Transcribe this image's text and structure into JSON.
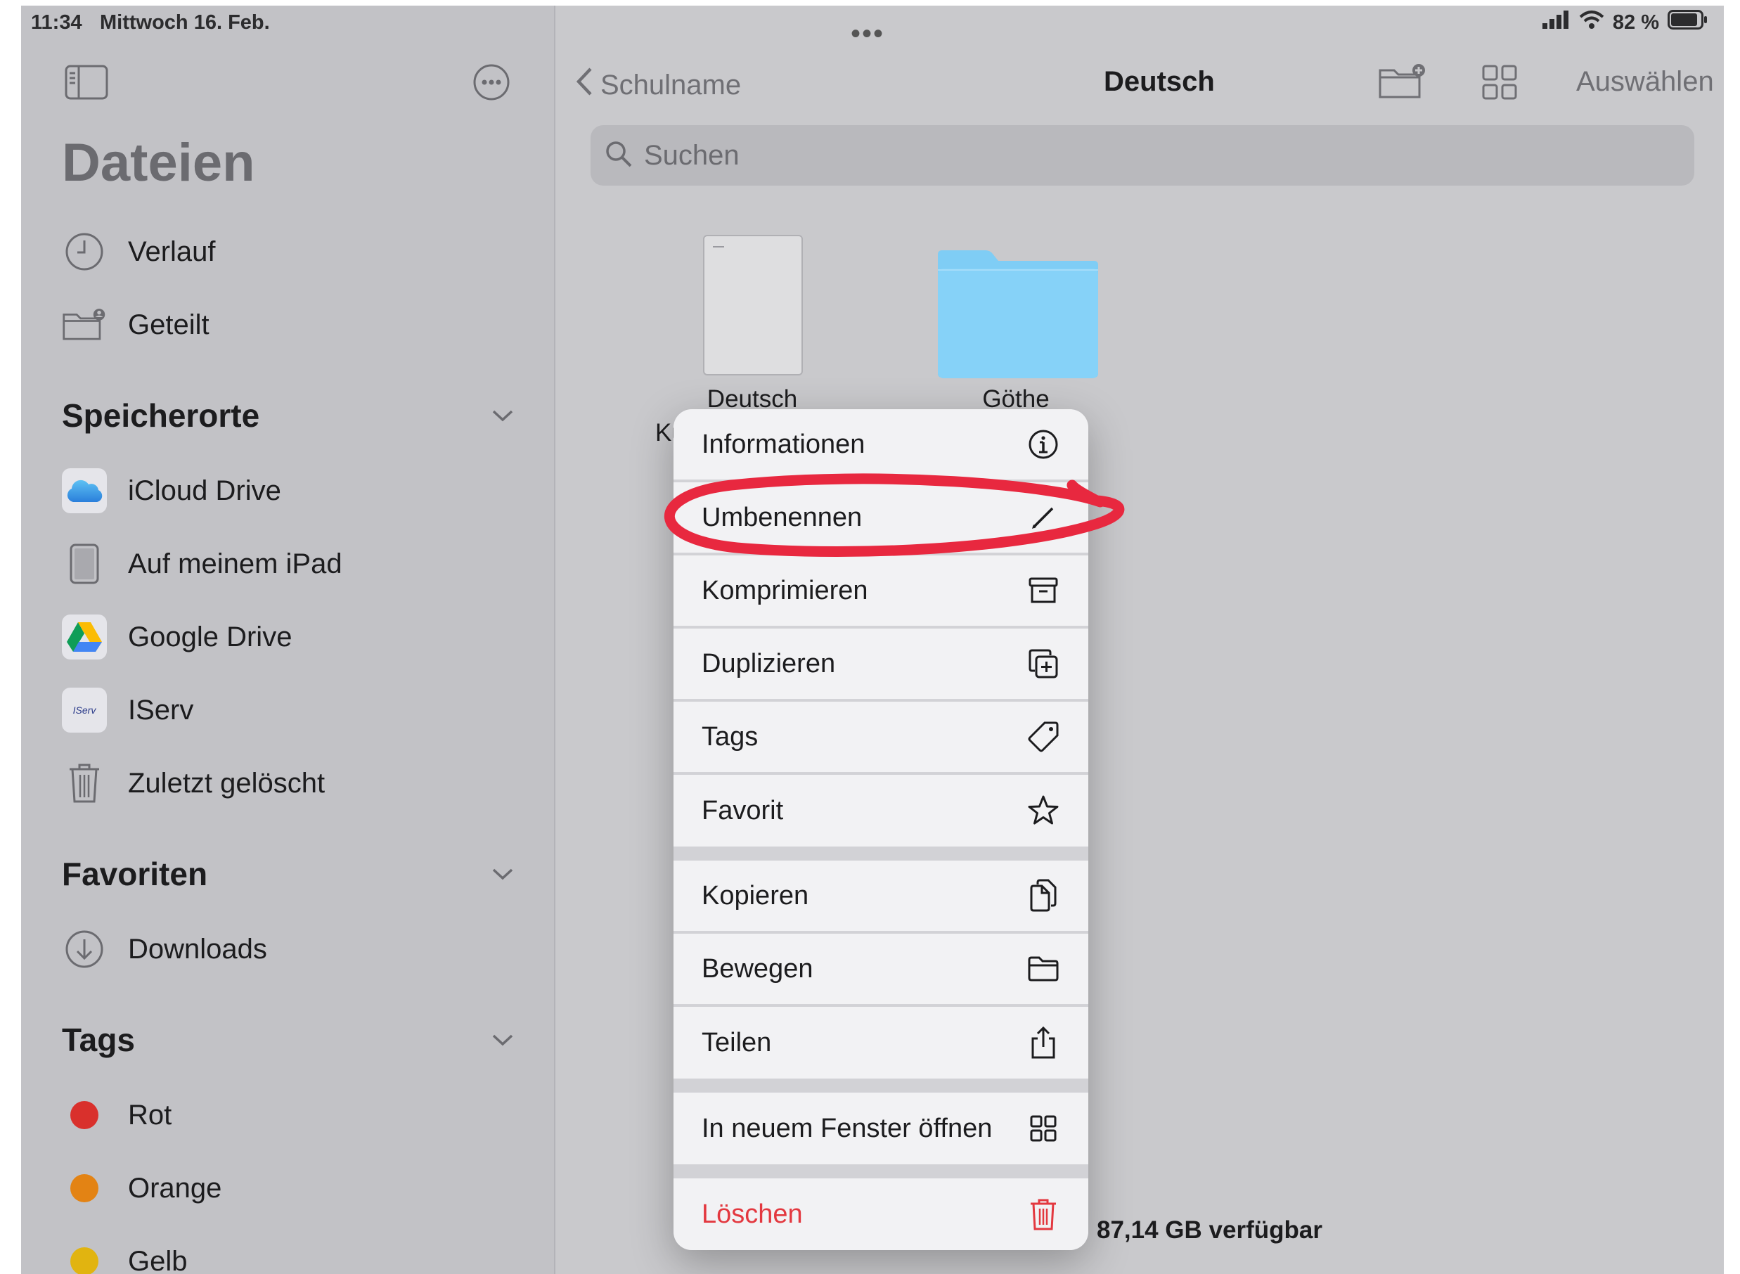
{
  "status": {
    "time": "11:34",
    "date": "Mittwoch 16. Feb.",
    "battery": "82 %"
  },
  "sidebar": {
    "title": "Dateien",
    "top_items": [
      {
        "label": "Verlauf",
        "icon": "clock-icon"
      },
      {
        "label": "Geteilt",
        "icon": "shared-folder-icon"
      }
    ],
    "sections": {
      "locations": "Speicherorte",
      "favorites": "Favoriten",
      "tags": "Tags"
    },
    "locations": [
      {
        "label": "iCloud Drive",
        "icon": "icloud-icon"
      },
      {
        "label": "Auf meinem iPad",
        "icon": "ipad-icon"
      },
      {
        "label": "Google Drive",
        "icon": "google-drive-icon"
      },
      {
        "label": "IServ",
        "icon": "iserv-icon",
        "logo_text": "IServ"
      },
      {
        "label": "Zuletzt gelöscht",
        "icon": "trash-icon"
      }
    ],
    "favorites": [
      {
        "label": "Downloads",
        "icon": "download-icon"
      }
    ],
    "tags": [
      {
        "label": "Rot",
        "color": "#d9302c"
      },
      {
        "label": "Orange",
        "color": "#e38314"
      },
      {
        "label": "Gelb",
        "color": "#e1b410"
      }
    ]
  },
  "main": {
    "back_label": "Schulname",
    "title": "Deutsch",
    "select_label": "Auswählen",
    "search_placeholder": "Suchen",
    "files": [
      {
        "label": "Deutsch",
        "label_partial": "Ku",
        "type": "document"
      },
      {
        "label": "Göthe",
        "type": "folder"
      }
    ],
    "storage": "87,14 GB verfügbar"
  },
  "context_menu": {
    "groups": [
      [
        {
          "label": "Informationen",
          "icon": "info-icon"
        },
        {
          "label": "Umbenennen",
          "icon": "pencil-icon",
          "annotated": true
        },
        {
          "label": "Komprimieren",
          "icon": "archive-box-icon"
        },
        {
          "label": "Duplizieren",
          "icon": "duplicate-icon"
        },
        {
          "label": "Tags",
          "icon": "tag-icon"
        },
        {
          "label": "Favorit",
          "icon": "star-icon"
        }
      ],
      [
        {
          "label": "Kopieren",
          "icon": "copy-icon"
        },
        {
          "label": "Bewegen",
          "icon": "folder-icon"
        },
        {
          "label": "Teilen",
          "icon": "share-icon"
        }
      ],
      [
        {
          "label": "In neuem Fenster öffnen",
          "icon": "new-window-icon"
        }
      ],
      [
        {
          "label": "Löschen",
          "icon": "trash-icon",
          "destructive": true
        }
      ]
    ]
  },
  "colors": {
    "annotation": "#e8283f",
    "destructive": "#e3383f",
    "folder": "#7fcdf5"
  }
}
